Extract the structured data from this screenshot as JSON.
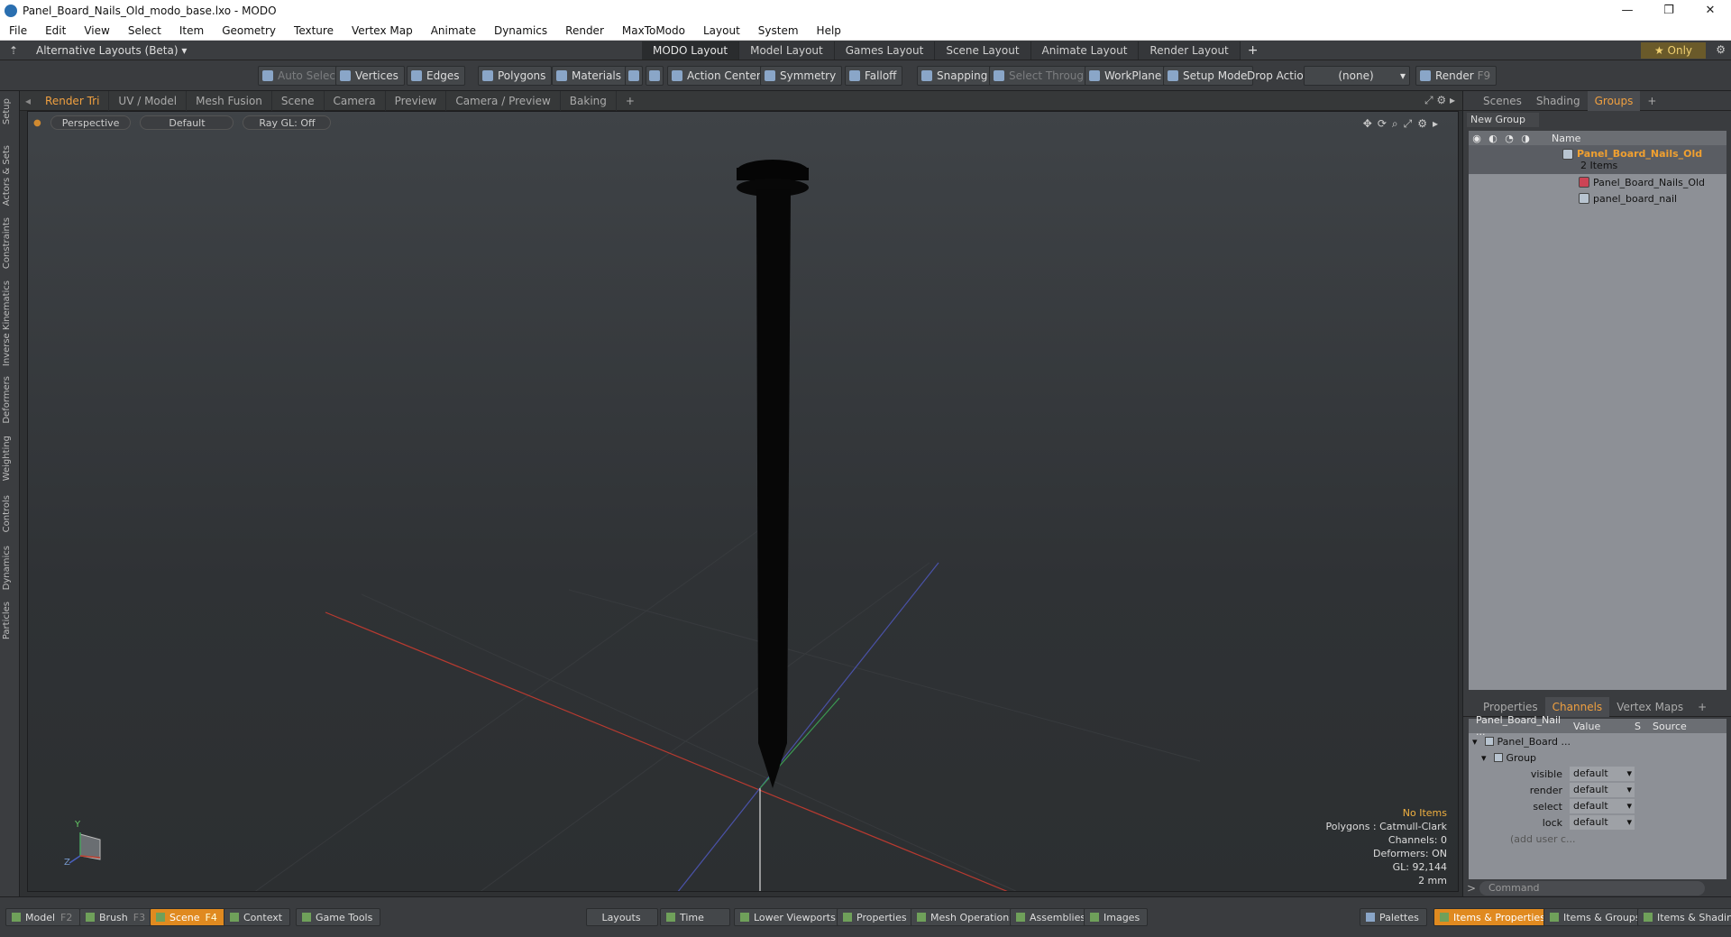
{
  "window": {
    "title": "Panel_Board_Nails_Old_modo_base.lxo - MODO"
  },
  "menu": [
    "File",
    "Edit",
    "View",
    "Select",
    "Item",
    "Geometry",
    "Texture",
    "Vertex Map",
    "Animate",
    "Dynamics",
    "Render",
    "MaxToModo",
    "Layout",
    "System",
    "Help"
  ],
  "layoutbar": {
    "alt_layouts": "Alternative Layouts (Beta) ▾",
    "tabs": [
      "MODO Layout",
      "Model Layout",
      "Games Layout",
      "Scene Layout",
      "Animate Layout",
      "Render Layout"
    ],
    "only": "★ Only"
  },
  "toolbar": {
    "auto_select": "Auto Select",
    "vertices": "Vertices",
    "edges": "Edges",
    "polygons": "Polygons",
    "materials": "Materials",
    "action_center": "Action Center",
    "symmetry": "Symmetry",
    "falloff": "Falloff",
    "snapping": "Snapping",
    "select_through": "Select Through",
    "workplane": "WorkPlane",
    "setup_mode": "Setup Mode",
    "drop_action": "Drop Action",
    "drop_value": "(none)",
    "render": "Render",
    "render_key": "F9"
  },
  "left_tabs": [
    "Setup",
    "Actors & Sets",
    "Constraints",
    "Inverse Kinematics",
    "Deformers",
    "Weighting",
    "Controls",
    "Dynamics",
    "Particles"
  ],
  "viewport_tabs": [
    "Render Tri",
    "UV / Model",
    "Mesh Fusion",
    "Scene",
    "Camera",
    "Camera / Preview",
    "Preview",
    "Baking",
    "+"
  ],
  "viewport": {
    "perspective": "Perspective",
    "shading": "Default",
    "raygl": "Ray GL: Off",
    "stats": {
      "items": "No Items",
      "polygons": "Polygons : Catmull-Clark",
      "channels": "Channels: 0",
      "deformers": "Deformers: ON",
      "gl": "GL: 92,144",
      "unit": "2 mm"
    },
    "axis": {
      "y": "Y",
      "z": "Z"
    }
  },
  "right_panel": {
    "tabs": [
      "Scenes",
      "Shading",
      "Groups",
      "+"
    ],
    "new_group": "New Group",
    "name_header": "Name",
    "group_name": "Panel_Board_Nails_Old",
    "group_count": "2 Items",
    "children": [
      "Panel_Board_Nails_Old",
      "panel_board_nail"
    ]
  },
  "channels": {
    "tabs": [
      "Properties",
      "Channels",
      "Vertex Maps",
      "+"
    ],
    "header_item": "Panel_Board_Nail ...",
    "header_value": "Value",
    "header_s": "S",
    "header_source": "Source",
    "tree_root": "Panel_Board ...",
    "tree_group": "Group",
    "rows": [
      {
        "name": "visible",
        "value": "default"
      },
      {
        "name": "render",
        "value": "default"
      },
      {
        "name": "select",
        "value": "default"
      },
      {
        "name": "lock",
        "value": "default"
      }
    ],
    "add_user": "(add user c...",
    "command_placeholder": "Command"
  },
  "bottombar": {
    "model": "Model",
    "model_key": "F2",
    "brush": "Brush",
    "brush_key": "F3",
    "scene": "Scene",
    "scene_key": "F4",
    "context": "Context",
    "game_tools": "Game Tools",
    "layouts": "Layouts",
    "time": "Time",
    "lower_viewports": "Lower Viewports",
    "properties": "Properties",
    "mesh_operations": "Mesh Operations",
    "assemblies": "Assemblies",
    "images": "Images",
    "palettes": "Palettes",
    "items_properties": "Items & Properties",
    "items_groups": "Items & Groups",
    "items_shading": "Items & Shading"
  },
  "colors": {
    "accent": "#f0a040",
    "active_tab": "#e08a20"
  }
}
